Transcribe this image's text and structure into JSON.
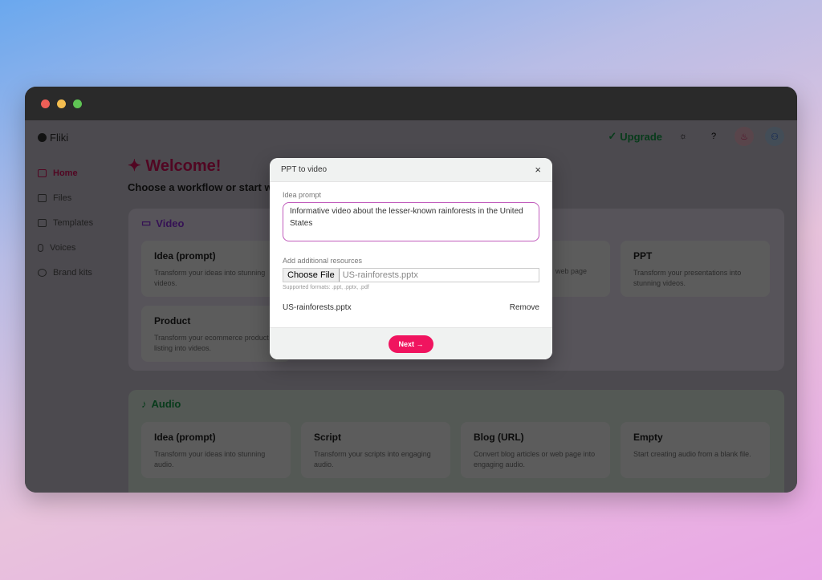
{
  "window": {
    "colors": {
      "close": "#ee5f57",
      "minimize": "#f4bd4f",
      "maximize": "#5fc454"
    }
  },
  "app": {
    "logo": "Fliki",
    "upgrade": "Upgrade",
    "sidebar": {
      "items": [
        {
          "label": "Home",
          "icon": "home-icon"
        },
        {
          "label": "Files",
          "icon": "folder-icon"
        },
        {
          "label": "Templates",
          "icon": "template-icon"
        },
        {
          "label": "Voices",
          "icon": "mic-icon"
        },
        {
          "label": "Brand kits",
          "icon": "palette-icon"
        }
      ]
    },
    "welcome": "Welcome!",
    "subtitle": "Choose a workflow or start w",
    "video": {
      "title": "Video",
      "cards": [
        {
          "title": "Idea (prompt)",
          "desc": "Transform your ideas into stunning videos."
        },
        {
          "title": "",
          "desc": ""
        },
        {
          "title": "",
          "desc": "web page"
        },
        {
          "title": "PPT",
          "desc": "Transform your presentations into stunning videos."
        },
        {
          "title": "Product",
          "desc": "Transform your ecommerce product listing into videos."
        }
      ]
    },
    "audio": {
      "title": "Audio",
      "cards": [
        {
          "title": "Idea (prompt)",
          "desc": "Transform your ideas into stunning audio."
        },
        {
          "title": "Script",
          "desc": "Transform your scripts into engaging audio."
        },
        {
          "title": "Blog (URL)",
          "desc": "Convert blog articles or web page into engaging audio."
        },
        {
          "title": "Empty",
          "desc": "Start creating audio from a blank file."
        }
      ]
    }
  },
  "modal": {
    "title": "PPT to video",
    "prompt_label": "Idea prompt",
    "prompt_value": "Informative video about the lesser-known rainforests in the United States",
    "resources_label": "Add additional resources",
    "choose_file": "Choose File",
    "file_name": "US-rainforests.pptx",
    "hint": "Supported formats: .ppt, .pptx, .pdf",
    "attached": "US-rainforests.pptx",
    "remove": "Remove",
    "next": "Next →",
    "close": "×"
  }
}
